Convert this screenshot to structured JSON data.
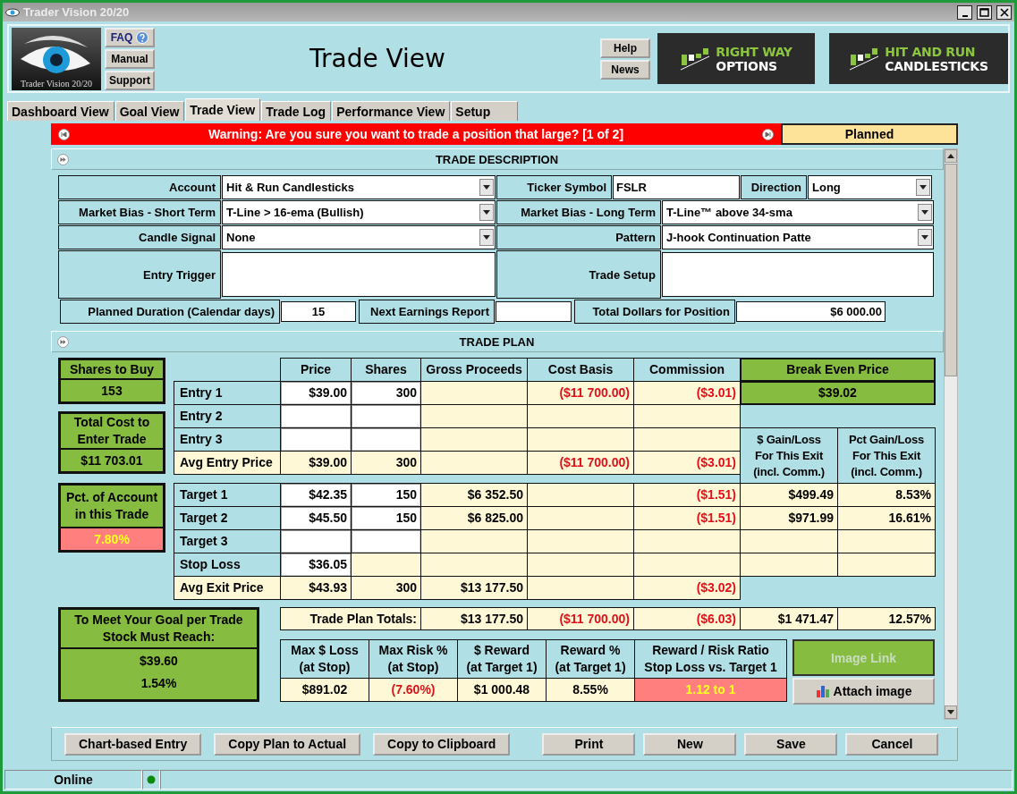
{
  "window": {
    "title": "Trader Vision 20/20"
  },
  "header": {
    "logo_caption": "Trader Vision 20/20",
    "help_buttons": [
      {
        "label": "FAQ",
        "kind": "faq"
      },
      {
        "label": "Manual",
        "kind": "plain"
      },
      {
        "label": "Support",
        "kind": "plain"
      }
    ],
    "title": "Trade View",
    "side_buttons": [
      "Help",
      "News"
    ],
    "banners": [
      {
        "line1": "RIGHT WAY",
        "line2": "OPTIONS"
      },
      {
        "line1": "HIT AND RUN",
        "line2": "CANDLESTICKS"
      }
    ]
  },
  "tabs": [
    {
      "label": "Dashboard View",
      "selected": false
    },
    {
      "label": "Goal View",
      "selected": false
    },
    {
      "label": "Trade View",
      "selected": true
    },
    {
      "label": "Trade Log",
      "selected": false
    },
    {
      "label": "Performance View",
      "selected": false
    },
    {
      "label": "Setup",
      "selected": false
    }
  ],
  "warning": {
    "text": "Warning: Are you sure you want to trade a position that large? [1 of 2]",
    "status": "Planned"
  },
  "trade_description": {
    "title": "TRADE DESCRIPTION",
    "fields": [
      {
        "label": "Account",
        "kind": "select",
        "value": "Hit & Run Candlesticks"
      },
      {
        "label": "Ticker Symbol",
        "kind": "input",
        "value": "FSLR"
      },
      {
        "label": "Direction",
        "kind": "select",
        "value": "Long"
      },
      {
        "label": "Market Bias - Short Term",
        "kind": "select",
        "value": "T-Line > 16-ema (Bullish)"
      },
      {
        "label": "Market Bias - Long Term",
        "kind": "select",
        "value": "T-Line™ above 34-sma"
      },
      {
        "label": "Candle Signal",
        "kind": "select",
        "value": "None"
      },
      {
        "label": "Pattern",
        "kind": "select",
        "value": "J-hook Continuation Patte"
      },
      {
        "label": "Entry Trigger",
        "kind": "textarea"
      },
      {
        "label": "Trade Setup",
        "kind": "textarea"
      },
      {
        "label": "Planned Duration (Calendar days)",
        "kind": "input",
        "value": "15"
      },
      {
        "label": "Next Earnings Report",
        "kind": "input"
      },
      {
        "label": "Total Dollars for Position",
        "kind": "input",
        "value": "$6 000.00"
      }
    ]
  },
  "trade_plan": {
    "title": "TRADE PLAN",
    "summary_boxes": [
      {
        "label": "Shares to Buy",
        "value": "153",
        "alert": false
      },
      {
        "label": "Total Cost to\nEnter Trade",
        "value": "$11 703.01",
        "alert": false
      },
      {
        "label": "Pct. of Account\nin this Trade",
        "value": "7.80%",
        "alert": true
      }
    ],
    "columns": [
      "Price",
      "Shares",
      "Gross Proceeds",
      "Cost Basis",
      "Commission"
    ],
    "break_even": {
      "label": "Break Even Price",
      "value": "$39.02"
    },
    "exit_columns": [
      "$ Gain/Loss\nFor This Exit\n(incl. Comm.)",
      "Pct Gain/Loss\nFor This Exit\n(incl. Comm.)"
    ],
    "entry_rows": [
      {
        "label": "Entry 1",
        "kind": "input",
        "price": "$39.00",
        "shares": "300",
        "cost": "($11 700.00)",
        "commission": "($3.01)"
      },
      {
        "label": "Entry 2",
        "kind": "input"
      },
      {
        "label": "Entry 3",
        "kind": "input"
      },
      {
        "label": "Avg Entry Price",
        "kind": "summary",
        "price": "$39.00",
        "shares": "300",
        "cost": "($11 700.00)",
        "commission": "($3.01)"
      }
    ],
    "exit_rows": [
      {
        "label": "Target 1",
        "kind": "input",
        "price": "$42.35",
        "shares": "150",
        "gross": "$6 352.50",
        "commission": "($1.51)",
        "gain": "$499.49",
        "pct": "8.53%"
      },
      {
        "label": "Target 2",
        "kind": "input",
        "price": "$45.50",
        "shares": "150",
        "gross": "$6 825.00",
        "commission": "($1.51)",
        "gain": "$971.99",
        "pct": "16.61%"
      },
      {
        "label": "Target 3",
        "kind": "input"
      },
      {
        "label": "Stop Loss",
        "kind": "stop",
        "price": "$36.05"
      },
      {
        "label": "Avg Exit Price",
        "kind": "summary",
        "price": "$43.93",
        "shares": "300",
        "gross": "$13 177.50",
        "commission": "($3.02)"
      }
    ],
    "goal": {
      "label": "To Meet Your Goal per Trade\nStock Must Reach:",
      "price": "$39.60",
      "pct": "1.54%"
    },
    "totals": {
      "label": "Trade Plan Totals:",
      "gross": "$13 177.50",
      "cost": "($11 700.00)",
      "commission": "($6.03)",
      "gain": "$1 471.47",
      "pct": "12.57%"
    },
    "metrics": [
      {
        "label": "Max $ Loss\n(at Stop)",
        "value": "$891.02",
        "negative": false,
        "alert": false
      },
      {
        "label": "Max Risk %\n(at Stop)",
        "value": "(7.60%)",
        "negative": true,
        "alert": false
      },
      {
        "label": "$ Reward\n(at Target 1)",
        "value": "$1 000.48",
        "negative": false,
        "alert": false
      },
      {
        "label": "Reward %\n(at Target 1)",
        "value": "8.55%",
        "negative": false,
        "alert": false
      },
      {
        "label": "Reward / Risk Ratio\nStop Loss vs. Target 1",
        "value": "1.12 to 1",
        "negative": false,
        "alert": true
      }
    ],
    "image_link": {
      "label": "Image Link",
      "disabled": true
    },
    "attach_button": "Attach image"
  },
  "footer_buttons_left": [
    "Chart-based Entry",
    "Copy Plan to Actual",
    "Copy to Clipboard"
  ],
  "footer_buttons_right": [
    "Print",
    "New",
    "Save",
    "Cancel"
  ],
  "status_bar": {
    "text": "Online",
    "color": "#0a8a0a"
  }
}
